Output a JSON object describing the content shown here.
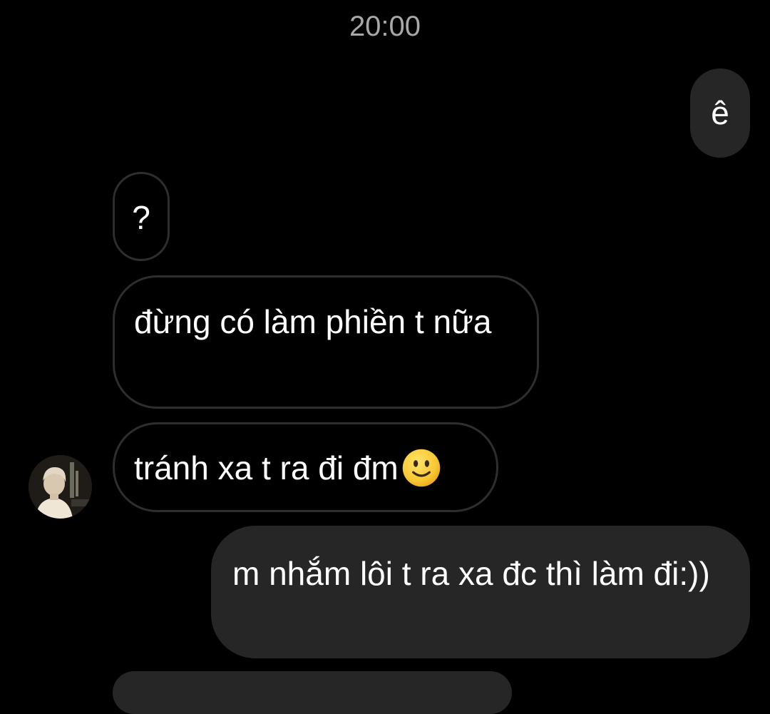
{
  "chat": {
    "timestamp": "20:00",
    "messages": [
      {
        "direction": "outgoing",
        "text": "ê"
      },
      {
        "direction": "incoming",
        "text": "?"
      },
      {
        "direction": "incoming",
        "text": "đừng có làm phiền t nữa"
      },
      {
        "direction": "incoming",
        "text": "tránh xa t ra đi đm",
        "emoji": "slightly-smiling-face-emoji"
      },
      {
        "direction": "outgoing",
        "text": "m nhắm lôi t ra xa đc thì làm đi:))"
      }
    ],
    "contact": {
      "avatar_icon": "contact-avatar"
    }
  },
  "colors": {
    "background": "#000000",
    "outgoing_bubble": "#262626",
    "incoming_border": "#2e2e2e",
    "timestamp_text": "#a8a8a8",
    "message_text": "#ffffff"
  }
}
